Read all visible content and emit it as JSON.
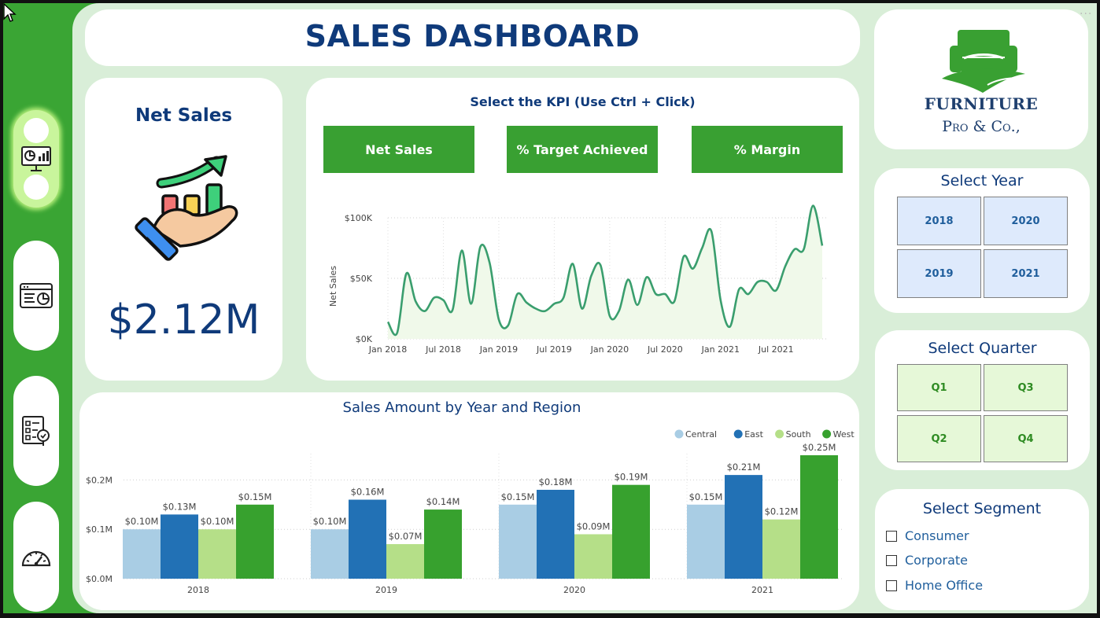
{
  "header": {
    "title": "SALES DASHBOARD"
  },
  "nav": {
    "items": [
      {
        "name": "dashboard-icon",
        "active": true
      },
      {
        "name": "report-icon",
        "active": false
      },
      {
        "name": "checklist-icon",
        "active": false
      },
      {
        "name": "gauge-icon",
        "active": false
      }
    ]
  },
  "kpi_card": {
    "title": "Net Sales",
    "value": "$2.12M",
    "icon": "hand-growth-chart-icon"
  },
  "kpi_selector": {
    "title": "Select the KPI (Use Ctrl + Click)",
    "buttons": [
      "Net Sales",
      "% Target Achieved",
      "% Margin"
    ]
  },
  "line_chart": {
    "type": "area",
    "ylabel": "Net Sales",
    "y_ticks": [
      "$100K",
      "$50K",
      "$0K"
    ],
    "x_ticks": [
      "Jan 2018",
      "Jul 2018",
      "Jan 2019",
      "Jul 2019",
      "Jan 2020",
      "Jul 2020",
      "Jan 2021",
      "Jul 2021"
    ],
    "ylim": [
      0,
      100000
    ],
    "x_months": [
      "2018-01",
      "2018-02",
      "2018-03",
      "2018-04",
      "2018-05",
      "2018-06",
      "2018-07",
      "2018-08",
      "2018-09",
      "2018-10",
      "2018-11",
      "2018-12",
      "2019-01",
      "2019-02",
      "2019-03",
      "2019-04",
      "2019-05",
      "2019-06",
      "2019-07",
      "2019-08",
      "2019-09",
      "2019-10",
      "2019-11",
      "2019-12",
      "2020-01",
      "2020-02",
      "2020-03",
      "2020-04",
      "2020-05",
      "2020-06",
      "2020-07",
      "2020-08",
      "2020-09",
      "2020-10",
      "2020-11",
      "2020-12",
      "2021-01",
      "2021-02",
      "2021-03",
      "2021-04",
      "2021-05",
      "2021-06",
      "2021-07",
      "2021-08",
      "2021-09",
      "2021-10",
      "2021-11",
      "2021-12"
    ],
    "values": [
      14000,
      5000,
      54000,
      31000,
      23000,
      34000,
      32000,
      24000,
      73000,
      29000,
      76000,
      63000,
      16000,
      11000,
      37000,
      30000,
      25000,
      23000,
      29000,
      34000,
      62000,
      25000,
      52000,
      61000,
      19000,
      23000,
      49000,
      28000,
      51000,
      37000,
      37000,
      31000,
      68000,
      58000,
      75000,
      89000,
      32000,
      10000,
      41000,
      37000,
      47000,
      47000,
      40000,
      60000,
      74000,
      74000,
      110000,
      77000
    ],
    "line_color": "#3a9e6e",
    "fill_color": "#f0f9ea"
  },
  "bar_chart": {
    "title": "Sales Amount by Year and Region",
    "y_ticks": [
      "$0.2M",
      "$0.1M",
      "$0.0M"
    ],
    "legend_position": "top-right"
  },
  "chart_data": [
    {
      "type": "bar",
      "title": "Sales Amount by Year and Region",
      "categories": [
        "2018",
        "2019",
        "2020",
        "2021"
      ],
      "series": [
        {
          "name": "Central",
          "color": "#a9cde4",
          "values": [
            0.1,
            0.1,
            0.15,
            0.15
          ],
          "labels": [
            "$0.10M",
            "$0.10M",
            "$0.15M",
            "$0.15M"
          ]
        },
        {
          "name": "East",
          "color": "#2271b5",
          "values": [
            0.13,
            0.16,
            0.18,
            0.21
          ],
          "labels": [
            "$0.13M",
            "$0.16M",
            "$0.18M",
            "$0.21M"
          ]
        },
        {
          "name": "South",
          "color": "#b5df88",
          "values": [
            0.1,
            0.07,
            0.09,
            0.12
          ],
          "labels": [
            "$0.10M",
            "$0.07M",
            "$0.09M",
            "$0.12M"
          ]
        },
        {
          "name": "West",
          "color": "#37a12e",
          "values": [
            0.15,
            0.14,
            0.19,
            0.25
          ],
          "labels": [
            "$0.15M",
            "$0.14M",
            "$0.19M",
            "$0.25M"
          ]
        }
      ],
      "ylim": [
        0,
        0.25
      ],
      "grid": true
    },
    {
      "type": "area",
      "ylabel": "Net Sales",
      "x_range": [
        "2018-01",
        "2021-12"
      ],
      "ylim": [
        0,
        100000
      ],
      "values": [
        14000,
        5000,
        54000,
        31000,
        23000,
        34000,
        32000,
        24000,
        73000,
        29000,
        76000,
        63000,
        16000,
        11000,
        37000,
        30000,
        25000,
        23000,
        29000,
        34000,
        62000,
        25000,
        52000,
        61000,
        19000,
        23000,
        49000,
        28000,
        51000,
        37000,
        37000,
        31000,
        68000,
        58000,
        75000,
        89000,
        32000,
        10000,
        41000,
        37000,
        47000,
        47000,
        40000,
        60000,
        74000,
        74000,
        110000,
        77000
      ]
    }
  ],
  "brand": {
    "line1": "FURNITURE",
    "line2": "Pro & Co.,",
    "icon": "armchair-logo-icon",
    "color": "#39a032",
    "text_color": "#1e3f6e"
  },
  "year_slicer": {
    "title": "Select Year",
    "options": [
      "2018",
      "2020",
      "2019",
      "2021"
    ]
  },
  "quarter_slicer": {
    "title": "Select Quarter",
    "options": [
      "Q1",
      "Q3",
      "Q2",
      "Q4"
    ]
  },
  "segment_slicer": {
    "title": "Select Segment",
    "options": [
      "Consumer",
      "Corporate",
      "Home Office"
    ]
  }
}
